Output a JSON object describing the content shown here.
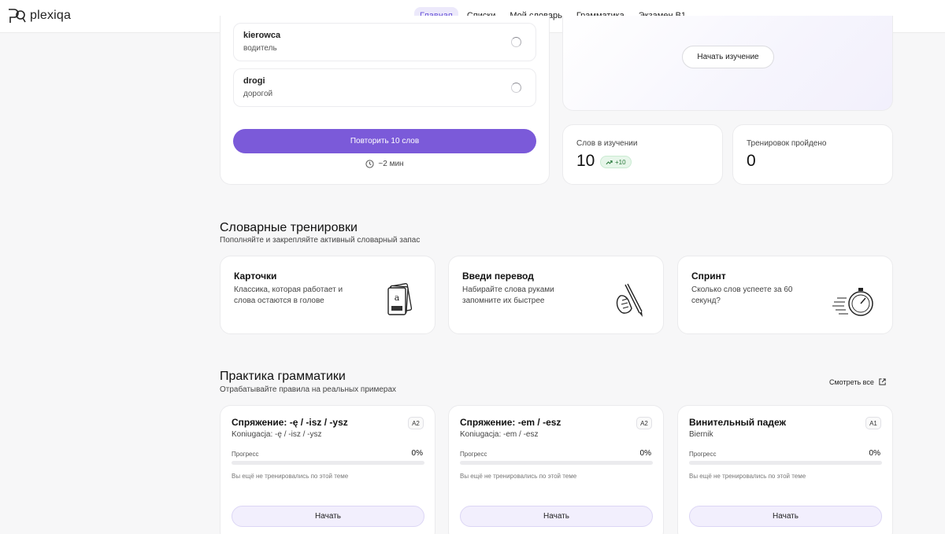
{
  "brand": {
    "name": "plexiqa"
  },
  "nav": {
    "items": [
      {
        "label": "Главная",
        "active": true
      },
      {
        "label": "Списки",
        "active": false
      },
      {
        "label": "Мой словарь",
        "active": false
      },
      {
        "label": "Грамматика",
        "active": false
      },
      {
        "label": "Экзамен B1",
        "active": false
      }
    ]
  },
  "review": {
    "words": [
      {
        "word": "kierowca",
        "translation": "водитель"
      },
      {
        "word": "drogi",
        "translation": "дорогой"
      }
    ],
    "button_label": "Повторить 10 слов",
    "duration": "~2 мин"
  },
  "start": {
    "button_label": "Начать изучение"
  },
  "stats": {
    "learning": {
      "label": "Слов в изучении",
      "value": "10",
      "badge": "+10"
    },
    "trainings": {
      "label": "Тренировок пройдено",
      "value": "0"
    }
  },
  "vocab_section": {
    "title": "Словарные тренировки",
    "subtitle": "Пополняйте и закрепляйте активный словарный запас",
    "cards": [
      {
        "title": "Карточки",
        "description": "Классика, которая работает и слова остаются в голове",
        "icon": "flashcards-icon"
      },
      {
        "title": "Введи перевод",
        "description": "Набирайте слова руками запомните их быстрее",
        "icon": "pencil-hand-icon"
      },
      {
        "title": "Спринт",
        "description": "Сколько слов успеете за 60 секунд?",
        "icon": "stopwatch-icon"
      }
    ]
  },
  "grammar_section": {
    "title": "Практика грамматики",
    "subtitle": "Отрабатывайте правила на реальных примерах",
    "see_all": "Смотреть все",
    "progress_label": "Прогресс",
    "no_training_note": "Вы ещё не тренировались по этой теме",
    "start_label": "Начать",
    "cards": [
      {
        "title": "Спряжение: -ę / -isz / -ysz",
        "subtitle": "Koniugacja: -ę / -isz / -ysz",
        "level": "A2",
        "progress": "0%",
        "progress_value": 0
      },
      {
        "title": "Спряжение: -em / -esz",
        "subtitle": "Koniugacja: -em / -esz",
        "level": "A2",
        "progress": "0%",
        "progress_value": 0
      },
      {
        "title": "Винительный падеж",
        "subtitle": "Biernik",
        "level": "A1",
        "progress": "0%",
        "progress_value": 0
      }
    ]
  },
  "colors": {
    "accent": "#7b5ad9",
    "nav_active_bg": "#ece9fb",
    "badge_green": "#2b7a3d"
  }
}
